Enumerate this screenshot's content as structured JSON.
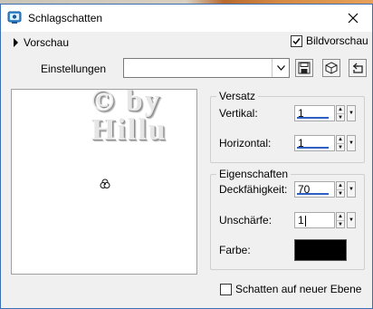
{
  "window": {
    "title": "Schlagschatten"
  },
  "toolbar": {
    "preview_label": "Vorschau",
    "bildvorschau_label": "Bildvorschau",
    "bildvorschau_checked": true,
    "settings_label": "Einstellungen",
    "settings_value": ""
  },
  "preview": {
    "watermark_line1": "© by",
    "watermark_line2": "Hillu"
  },
  "versatz": {
    "legend": "Versatz",
    "vertical_label": "Vertikal:",
    "vertical_value": "1",
    "horizontal_label": "Horizontal:",
    "horizontal_value": "1"
  },
  "eigenschaften": {
    "legend": "Eigenschaften",
    "opacity_label": "Deckfähigkeit:",
    "opacity_value": "70",
    "blur_label": "Unschärfe:",
    "blur_value": "1",
    "color_label": "Farbe:",
    "color": "#000000"
  },
  "footer": {
    "new_layer_label": "Schatten auf neuer Ebene",
    "new_layer_checked": false
  },
  "colors": {
    "accent": "#2f5fc0",
    "frame": "#3a6fb5"
  }
}
